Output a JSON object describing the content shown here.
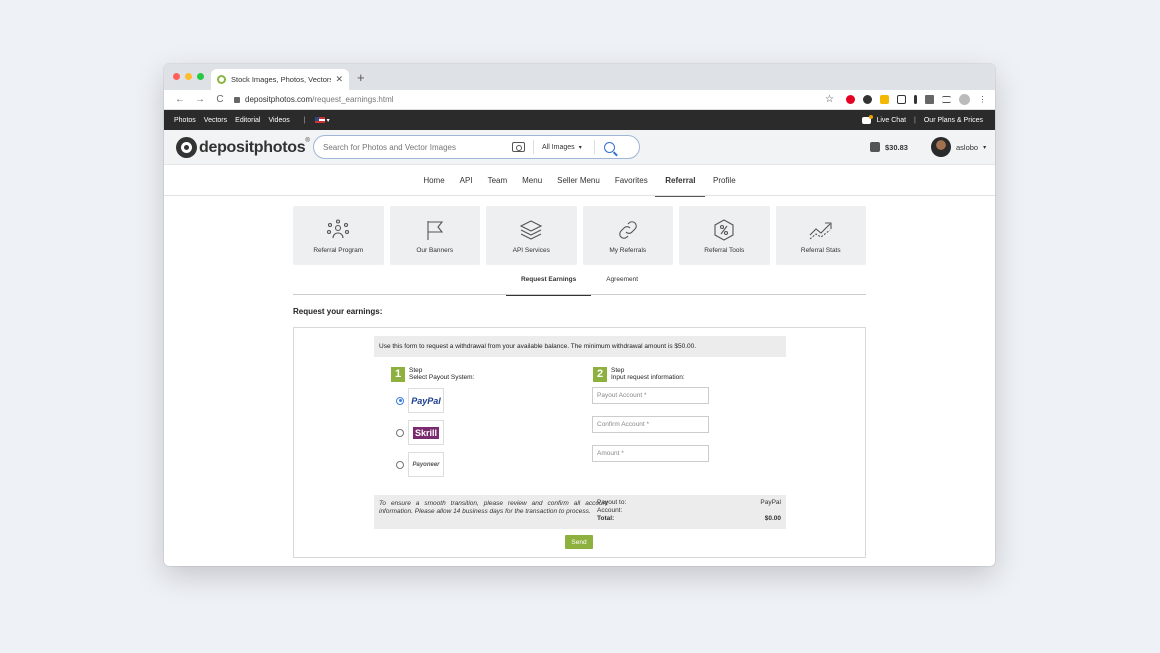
{
  "browser": {
    "tab_title": "Stock Images, Photos, Vectors,",
    "tab_close": "✕",
    "new_tab": "+",
    "nav_back": "←",
    "nav_forward": "→",
    "nav_reload": "C",
    "url_domain": "depositphotos.com",
    "url_path": "/request_earnings.html",
    "star": "☆",
    "menu_dots": "⋮"
  },
  "topbar": {
    "links": [
      "Photos",
      "Vectors",
      "Editorial",
      "Videos"
    ],
    "separator": "|",
    "lang_caret": "▾",
    "live_chat": "Live Chat",
    "divider": "|",
    "plans": "Our Plans & Prices"
  },
  "header": {
    "logo_text": "depositphotos",
    "logo_reg": "®",
    "search_placeholder": "Search for Photos and Vector Images",
    "filter_label": "All Images",
    "filter_caret": "▾",
    "balance": "$30.83",
    "username": "aslobo",
    "user_caret": "▾"
  },
  "mainnav": {
    "items": [
      "Home",
      "API",
      "Team",
      "Menu",
      "Seller Menu",
      "Favorites",
      "Referral",
      "Profile"
    ],
    "active": "Referral"
  },
  "cards": [
    {
      "label": "Referral Program",
      "icon": "people-network-icon"
    },
    {
      "label": "Our Banners",
      "icon": "flag-icon"
    },
    {
      "label": "API Services",
      "icon": "layers-icon"
    },
    {
      "label": "My Referrals",
      "icon": "link-icon"
    },
    {
      "label": "Referral Tools",
      "icon": "percent-tag-icon"
    },
    {
      "label": "Referral Stats",
      "icon": "trend-chart-icon"
    }
  ],
  "subtabs": {
    "request": "Request Earnings",
    "agreement": "Agreement"
  },
  "form": {
    "title": "Request your earnings:",
    "notice": "Use this form to request a withdrawal from your available balance. The minimum withdrawal amount is $50.00.",
    "step1_num": "1",
    "step1_word": "Step",
    "step1_desc": "Select Payout System:",
    "step2_num": "2",
    "step2_word": "Step",
    "step2_desc": "Input request information:",
    "payout_options": [
      "PayPal",
      "Skrill",
      "Payoneer"
    ],
    "selected": "PayPal",
    "fields": {
      "payout_account": "Payout Account *",
      "confirm_account": "Confirm Account *",
      "amount": "Amount *"
    },
    "summary_note": "To ensure a smooth transition, please review and confirm all account information. Please allow 14 business days for the transaction to process.",
    "payout_to_label": "Payout to:",
    "payout_to_value": "PayPal",
    "account_label": "Account:",
    "account_value": "",
    "total_label": "Total:",
    "total_value": "$0.00",
    "send": "Send"
  },
  "colors": {
    "accent_green": "#8eb03f",
    "topbar_bg": "#2b2b2b",
    "search_blue": "#2f6fd6"
  }
}
